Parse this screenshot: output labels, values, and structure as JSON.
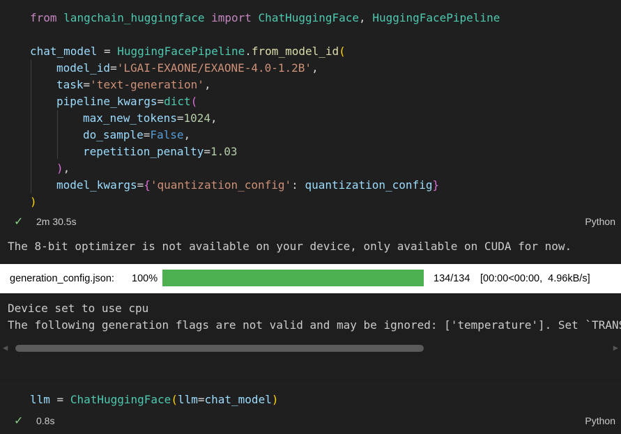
{
  "cell1": {
    "code_tokens": {
      "l1": [
        "from",
        " ",
        "langchain_huggingface",
        " ",
        "import",
        " ",
        "ChatHuggingFace",
        ", ",
        "HuggingFacePipeline"
      ],
      "l3": [
        "chat_model",
        " = ",
        "HuggingFacePipeline",
        ".",
        "from_model_id",
        "("
      ],
      "l4": [
        "model_id",
        "=",
        "'LGAI-EXAONE/EXAONE-4.0-1.2B'",
        ","
      ],
      "l5": [
        "task",
        "=",
        "'text-generation'",
        ","
      ],
      "l6": [
        "pipeline_kwargs",
        "=",
        "dict",
        "("
      ],
      "l7": [
        "max_new_tokens",
        "=",
        "1024",
        ","
      ],
      "l8": [
        "do_sample",
        "=",
        "False",
        ","
      ],
      "l9": [
        "repetition_penalty",
        "=",
        "1.03"
      ],
      "l10": [
        ")",
        ","
      ],
      "l11": [
        "model_kwargs",
        "=",
        "{",
        "'quantization_config'",
        ": ",
        "quantization_config",
        "}"
      ],
      "l12": [
        ")"
      ]
    },
    "status": {
      "check": "✓",
      "duration": "2m 30.5s",
      "language": "Python"
    }
  },
  "output": {
    "warning": "The 8-bit optimizer is not available on your device, only available on CUDA for now.",
    "progress": {
      "filename": "generation_config.json:",
      "percent_label": "100%",
      "fraction": 1.0,
      "count": "134/134",
      "timing": "[00:00<00:00,  4.96kB/s]",
      "bar_color": "#4caf50"
    },
    "device_line": "Device set to use cpu",
    "flags_line": "The following generation flags are not valid and may be ignored: ['temperature']. Set `TRANS",
    "scroll_left": "◀",
    "scroll_right": "▶"
  },
  "cell2": {
    "code_tokens": [
      "llm",
      " = ",
      "ChatHuggingFace",
      "(",
      "llm",
      "=",
      "chat_model",
      ")"
    ],
    "status": {
      "check": "✓",
      "duration": "0.8s",
      "language": "Python"
    }
  }
}
